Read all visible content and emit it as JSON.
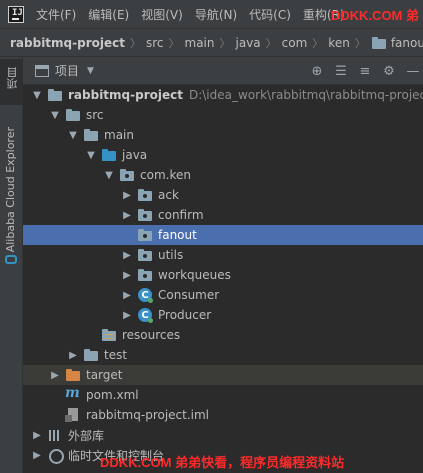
{
  "menubar": {
    "items": [
      "文件(F)",
      "编辑(E)",
      "视图(V)",
      "导航(N)",
      "代码(C)",
      "重构(R)"
    ],
    "watermark": "DDKK.COM 弟"
  },
  "breadcrumb": {
    "items": [
      "rabbitmq-project",
      "src",
      "main",
      "java",
      "com",
      "ken",
      "fanout"
    ]
  },
  "leftstrip": {
    "project": "项目",
    "cloud": "Alibaba Cloud Explorer"
  },
  "project_panel": {
    "title": "项目"
  },
  "tree": {
    "root": {
      "label": "rabbitmq-project",
      "path": "D:\\idea_work\\rabbitmq\\rabbitmq-project"
    },
    "src": "src",
    "main": "main",
    "java": "java",
    "com_ken": "com.ken",
    "ack": "ack",
    "confirm": "confirm",
    "fanout": "fanout",
    "utils": "utils",
    "workqueues": "workqueues",
    "consumer": "Consumer",
    "producer": "Producer",
    "resources": "resources",
    "test": "test",
    "target": "target",
    "pom": "pom.xml",
    "iml": "rabbitmq-project.iml",
    "external_libs": "外部库",
    "scratches": "临时文件和控制台"
  },
  "watermark_bottom": "DDKK.COM 弟弟快看，程序员编程资料站",
  "colors": {
    "selection": "#4b6eaf",
    "watermark": "#ff2a2a",
    "source_folder": "#3592c4",
    "excluded_folder": "#d68547"
  }
}
